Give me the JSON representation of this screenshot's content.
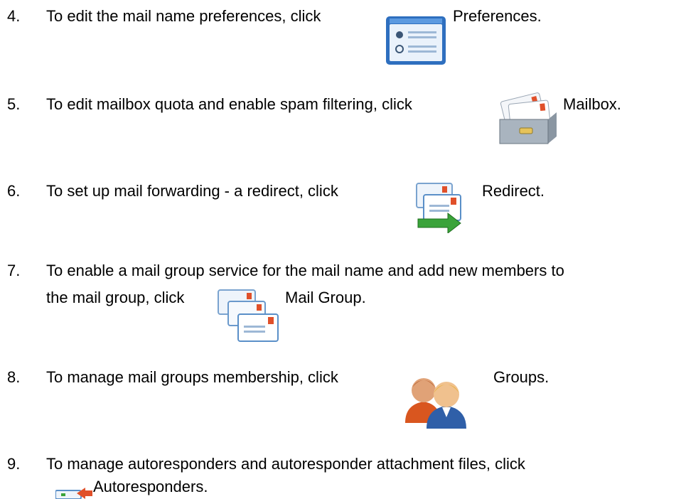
{
  "steps": [
    {
      "number": "4.",
      "text": "To edit the mail name preferences, click",
      "label": "Preferences.",
      "icon": "preferences-icon"
    },
    {
      "number": "5.",
      "text": "To edit mailbox quota and enable spam filtering, click",
      "label": "Mailbox.",
      "icon": "mailbox-icon"
    },
    {
      "number": "6.",
      "text": "To set up mail forwarding - a redirect, click",
      "label": "Redirect.",
      "icon": "redirect-icon"
    },
    {
      "number": "7.",
      "text": "To enable a mail group service for the mail name and add new members to",
      "text2": "the mail group, click",
      "label": "Mail Group.",
      "icon": "mail-group-icon"
    },
    {
      "number": "8.",
      "text": "To manage mail groups membership, click",
      "label": "Groups.",
      "icon": "groups-icon"
    },
    {
      "number": "9.",
      "text": "To manage autoresponders and autoresponder attachment files, click",
      "label": "Autoresponders.",
      "icon": "autoresponders-icon"
    }
  ],
  "colors": {
    "text": "#000000",
    "icon_blue": "#3a7fc9",
    "icon_light": "#e8f1fb",
    "envelope_red": "#e0502a",
    "arrow_green": "#3aa33a",
    "drawer_gray": "#7e8a96"
  }
}
